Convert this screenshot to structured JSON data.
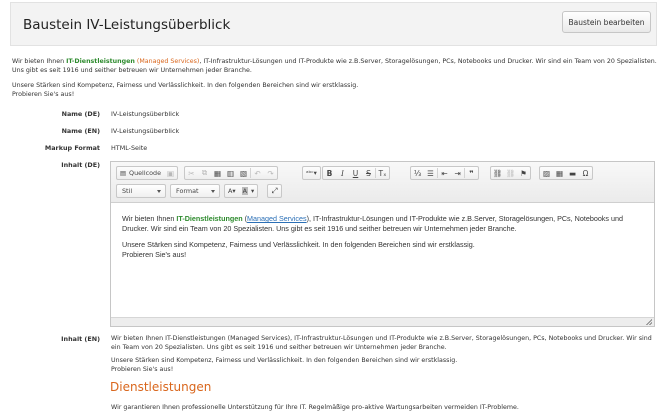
{
  "header": {
    "title": "Baustein IV-Leistungsüberblick",
    "edit_button": "Baustein bearbeiten"
  },
  "intro": {
    "p1_before": "Wir bieten Ihnen ",
    "p1_highlight": "IT-Dienstleistungen",
    "p1_paren": "(Managed Services)",
    "p1_after": ", IT-Infrastruktur-Lösungen und IT-Produkte wie z.B.Server, Storagelösungen, PCs, Notebooks und Drucker. Wir sind ein Team von 20 Spezialisten. Uns gibt es seit 1916 und seither betreuen wir Unternehmen jeder Branche.",
    "p2_line1": "Unsere Stärken sind Kompetenz, Fairness und Verlässlichkeit. In den folgenden Bereichen sind wir erstklassig.",
    "p2_line2": "Probieren Sie's aus!"
  },
  "fields": {
    "name_de_label": "Name (DE)",
    "name_de_value": "IV-Leistungsüberblick",
    "name_en_label": "Name (EN)",
    "name_en_value": "IV-Leistungsüberblick",
    "markup_label": "Markup Format",
    "markup_value": "HTML-Seite",
    "inhalt_de_label": "Inhalt (DE)",
    "inhalt_en_label": "Inhalt (EN)"
  },
  "toolbar": {
    "source_label": "Quellcode",
    "style_combo": "Stil",
    "format_combo": "Format",
    "icons": [
      "source-icon",
      "save-icon",
      "cut-icon",
      "copy-icon",
      "paste-icon",
      "paste-text-icon",
      "paste-word-icon",
      "undo-icon",
      "redo-icon",
      "spellcheck-icon",
      "bold-icon",
      "italic-icon",
      "underline-icon",
      "strike-icon",
      "remove-format-icon",
      "numbered-list-icon",
      "bulleted-list-icon",
      "outdent-icon",
      "indent-icon",
      "blockquote-icon",
      "link-icon",
      "unlink-icon",
      "anchor-icon",
      "image-icon",
      "table-icon",
      "horizontal-rule-icon",
      "special-char-icon",
      "text-color-icon",
      "bg-color-icon",
      "maximize-icon"
    ]
  },
  "editor": {
    "p1_before": "Wir bieten Ihnen ",
    "p1_highlight": "IT-Dienstleistungen",
    "p1_link": "Managed Services",
    "p1_after": ", IT-Infrastruktur-Lösungen und IT-Produkte wie z.B.Server, Storagelösungen, PCs, Notebooks und Drucker. Wir sind ein Team von 20 Spezialisten. Uns gibt es seit 1916 und seither betreuen wir Unternehmen jeder Branche.",
    "p2_line1": "Unsere Stärken sind Kompetenz, Fairness und Verlässlichkeit. In den folgenden Bereichen sind wir erstklassig.",
    "p2_line2": "Probieren Sie's aus!"
  },
  "preview_en": {
    "p1": "Wir bieten Ihnen IT-Dienstleistungen (Managed Services), IT-Infrastruktur-Lösungen und IT-Produkte wie z.B.Server, Storagelösungen, PCs, Notebooks und Drucker. Wir sind ein Team von 20 Spezialisten. Uns gibt es seit 1916 und seither betreuen wir Unternehmen jeder Branche.",
    "p2_line1": "Unsere Stärken sind Kompetenz, Fairness und Verlässlichkeit. In den folgenden Bereichen sind wir erstklassig.",
    "p2_line2": "Probieren Sie's aus!",
    "section_title": "Dienstleistungen",
    "section_text": "Wir garantieren Ihnen professionelle Unterstützung für Ihre IT. Regelmäßige pro-aktive Wartungsarbeiten vermeiden IT-Probleme."
  },
  "colors": {
    "highlight_green": "#2e8b2e",
    "accent_orange": "#d9661c",
    "link_blue": "#2a6fb6"
  }
}
